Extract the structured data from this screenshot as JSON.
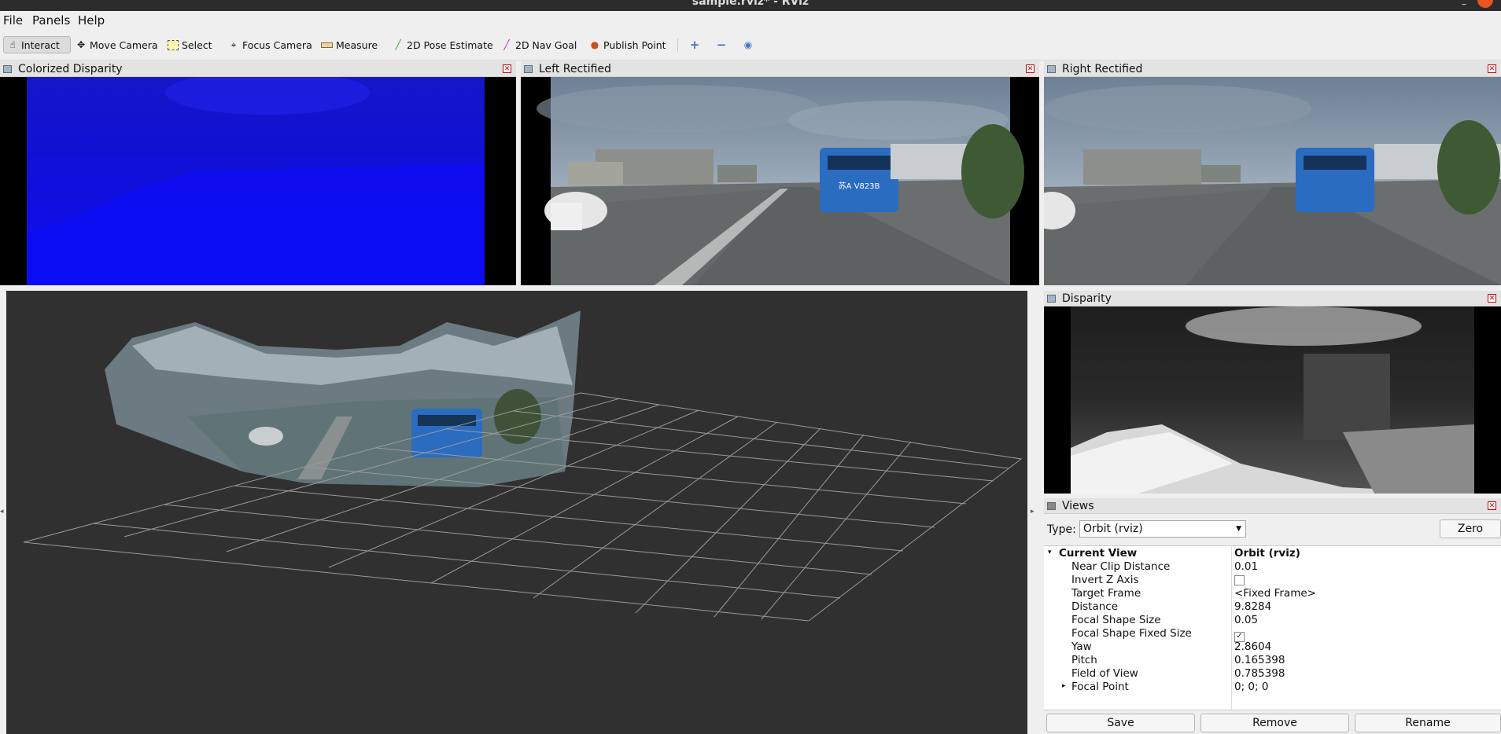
{
  "window": {
    "title": "sample.rviz* - RViz"
  },
  "menu": {
    "file": "File",
    "panels": "Panels",
    "help": "Help"
  },
  "toolbar": {
    "interact": "Interact",
    "move_camera": "Move Camera",
    "select": "Select",
    "focus_camera": "Focus Camera",
    "measure": "Measure",
    "pose_estimate": "2D Pose Estimate",
    "nav_goal": "2D Nav Goal",
    "publish_point": "Publish Point"
  },
  "panels": {
    "colorized_disparity": "Colorized Disparity",
    "left_rectified": "Left Rectified",
    "right_rectified": "Right Rectified",
    "disparity": "Disparity",
    "views": "Views"
  },
  "views": {
    "type_label": "Type:",
    "type_value": "Orbit (rviz)",
    "zero_button": "Zero",
    "current_view": {
      "key": "Current View",
      "value": "Orbit (rviz)"
    },
    "properties": [
      {
        "key": "Near Clip Distance",
        "value": "0.01"
      },
      {
        "key": "Invert Z Axis",
        "value": ""
      },
      {
        "key": "Target Frame",
        "value": "<Fixed Frame>"
      },
      {
        "key": "Distance",
        "value": "9.8284"
      },
      {
        "key": "Focal Shape Size",
        "value": "0.05"
      },
      {
        "key": "Focal Shape Fixed Size",
        "value": ""
      },
      {
        "key": "Yaw",
        "value": "2.8604"
      },
      {
        "key": "Pitch",
        "value": "0.165398"
      },
      {
        "key": "Field of View",
        "value": "0.785398"
      },
      {
        "key": "Focal Point",
        "value": "0; 0; 0"
      }
    ],
    "invert_z_checked": false,
    "focal_fixed_checked": true,
    "buttons": {
      "save": "Save",
      "remove": "Remove",
      "rename": "Rename"
    }
  },
  "scene": {
    "bus_plate": "苏A V823B"
  },
  "colors": {
    "viewport_bg": "#303030",
    "disparity_blue": "#1010e6",
    "accent": "#e95420"
  }
}
